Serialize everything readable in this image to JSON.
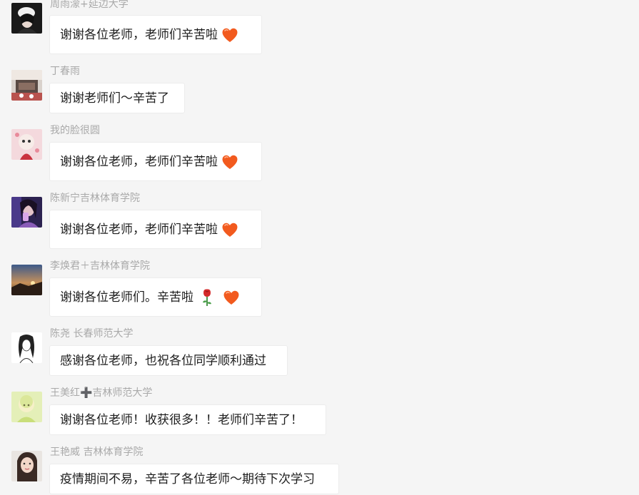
{
  "messages": [
    {
      "sender": "周雨濛+延边大学",
      "text": "谢谢各位老师，老师们辛苦啦",
      "emoji": "heart-icon"
    },
    {
      "sender": "丁春雨",
      "text": "谢谢老师们～辛苦了",
      "emoji": ""
    },
    {
      "sender": "我的脸很圆",
      "text": "谢谢各位老师，老师们辛苦啦",
      "emoji": "heart-icon"
    },
    {
      "sender": "陈新宁吉林体育学院",
      "text": "谢谢各位老师，老师们辛苦啦",
      "emoji": "heart-icon"
    },
    {
      "sender": "李焕君＋吉林体育学院",
      "text": "谢谢各位老师们。辛苦啦",
      "emoji": "rose-and-heart-icon"
    },
    {
      "sender": "陈尧 长春师范大学",
      "text": "感谢各位老师，也祝各位同学顺利通过",
      "emoji": ""
    },
    {
      "sender": "王美红➕吉林师范大学",
      "text": "谢谢各位老师！收获很多！！老师们辛苦了！",
      "emoji": ""
    },
    {
      "sender": "王艳威 吉林体育学院",
      "text": "疫情期间不易，辛苦了各位老师～期待下次学习",
      "emoji": ""
    }
  ],
  "colors": {
    "background": "#f5f5f5",
    "bubble": "#ffffff",
    "sender_name": "#a9a9a9",
    "message_text": "#1d1d1d",
    "heart": "#f25a1e"
  }
}
